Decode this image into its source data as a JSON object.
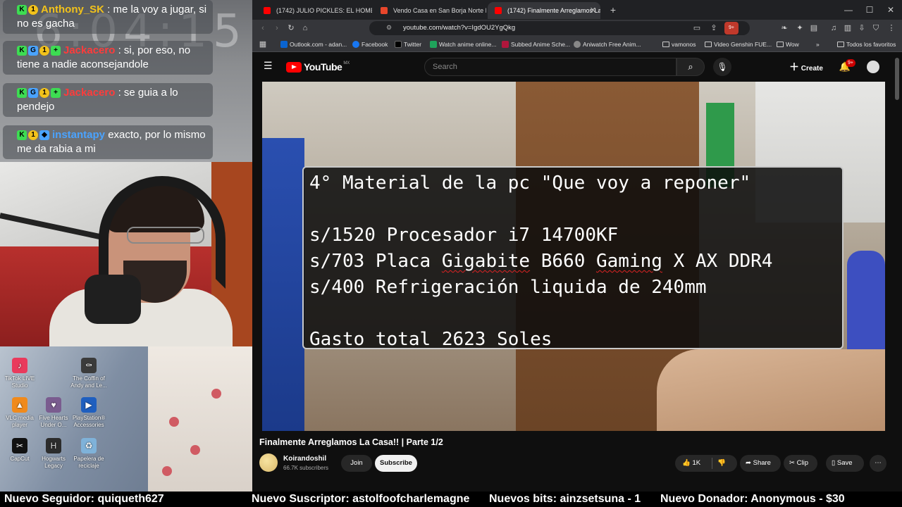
{
  "overlay": {
    "clock": "6:04:15",
    "chat": [
      {
        "user": "Anthony_SK",
        "color": "#f2c21b",
        "text": "me la voy a jugar, si no es gacha"
      },
      {
        "user": "Jackacero",
        "color": "#ff3b3b",
        "text": "si, por eso, no tiene a nadie aconsejandole"
      },
      {
        "user": "Jackacero",
        "color": "#ff3b3b",
        "text": "se guia a lo pendejo"
      },
      {
        "user": "instantapy",
        "color": "#4aa3ff",
        "text": "exacto, por lo mismo me da rabia a mi"
      }
    ],
    "desktop_icons": [
      {
        "label": "TikTok LIVE Studio",
        "icon": "tiktok-icon",
        "color": "#e93a5c"
      },
      {
        "label": "The Coffin of Andy and Le...",
        "icon": "coffin-icon",
        "color": "#3b3b3b"
      },
      {
        "label": "VLC media player",
        "icon": "vlc-icon",
        "color": "#f08a1c"
      },
      {
        "label": "Five Hearts Under O...",
        "icon": "five-hearts-icon",
        "color": "#7a5c8f"
      },
      {
        "label": "PlayStation® Accessories",
        "icon": "playstation-icon",
        "color": "#1f5fbf"
      },
      {
        "label": "CapCut",
        "icon": "capcut-icon",
        "color": "#111111"
      },
      {
        "label": "Hogwarts Legacy",
        "icon": "hogwarts-icon",
        "color": "#2c2c2c"
      },
      {
        "label": "Papelera de reciclaje",
        "icon": "recycle-bin-icon",
        "color": "#7fb2d9"
      }
    ]
  },
  "browser": {
    "tabs": [
      {
        "title": "(1742) JULIO PICKLES: EL HOMBRE M",
        "favicon": "youtube-icon",
        "active": false
      },
      {
        "title": "Vendo Casa en San Borja Norte Para",
        "favicon": "realestate-icon",
        "active": false
      },
      {
        "title": "(1742) Finalmente Arreglamos La",
        "favicon": "youtube-icon",
        "active": true
      }
    ],
    "new_tab": "+",
    "url": "youtube.com/watch?v=IgdOU2YgQkg",
    "bookmarks": [
      {
        "label": "Outlook.com - adan...",
        "icon": "outlook-icon"
      },
      {
        "label": "Facebook",
        "icon": "facebook-icon"
      },
      {
        "label": "Twitter",
        "icon": "x-icon"
      },
      {
        "label": "Watch anime online...",
        "icon": "anime-icon"
      },
      {
        "label": "Subbed Anime Sche...",
        "icon": "schedule-icon"
      },
      {
        "label": "Aniwatch Free Anim...",
        "icon": "aniwatch-icon"
      },
      {
        "label": "vamonos",
        "icon": "folder-icon"
      },
      {
        "label": "Video Genshin FUE...",
        "icon": "folder-icon"
      },
      {
        "label": "Wow",
        "icon": "folder-icon"
      }
    ],
    "bookmarks_more": "»",
    "all_bookmarks": "Todos los favoritos",
    "extension_badge": "9+"
  },
  "youtube": {
    "logo_text": "YouTube",
    "region": "MX",
    "search_placeholder": "Search",
    "create_label": "Create",
    "notif_count": "9+",
    "video_overlay": [
      {
        "text": "4° Material de la pc \"Que voy a reponer\""
      },
      {
        "text": ""
      },
      {
        "text": "s/1520 Procesador i7 14700KF"
      },
      {
        "text": "s/703 Placa Gigabite B660 Gaming X AX DDR4"
      },
      {
        "text": "s/400 Refrigeración liquida de 240mm"
      },
      {
        "text": ""
      },
      {
        "text": "Gasto total 2623 Soles"
      }
    ],
    "title": "Finalmente Arreglamos La Casa!! | Parte 1/2",
    "channel": "Koirandoshil",
    "subscribers": "66.7K subscribers",
    "join_label": "Join",
    "subscribe_label": "Subscribe",
    "likes": "1K",
    "share_label": "Share",
    "clip_label": "Clip",
    "save_label": "Save"
  },
  "ticker": {
    "follower": "Nuevo Seguidor: quiqueth627",
    "subscriber": "Nuevo Suscriptor: astolfoofcharlemagne",
    "bits": "Nuevos bits: ainzsetsuna - 1",
    "donor": "Nuevo Donador: Anonymous - $30"
  }
}
